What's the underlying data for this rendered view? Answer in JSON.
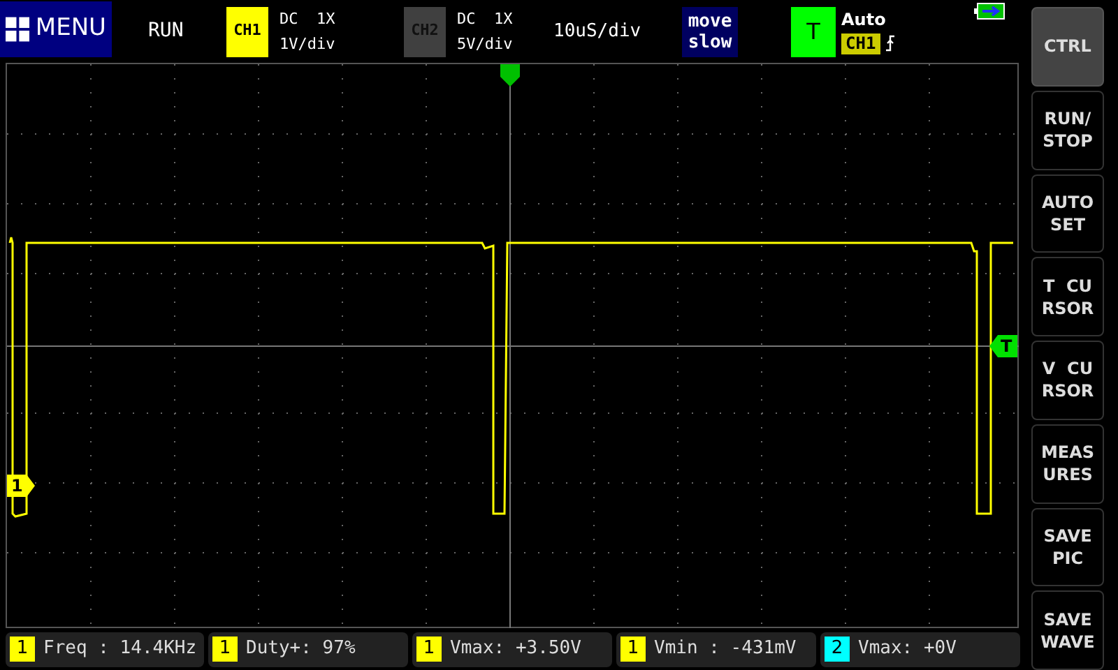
{
  "top_bar": {
    "menu": {
      "label": "MENU"
    },
    "run_state": "RUN",
    "channels": [
      {
        "badge": "CH1",
        "color": "#ffff00",
        "coupling": "DC  1X",
        "scale": "1V/div",
        "enabled": true
      },
      {
        "badge": "CH2",
        "color": "#404040",
        "coupling": "DC  1X",
        "scale": "5V/div",
        "enabled": false
      }
    ],
    "timebase": "10uS/div",
    "move_mode": {
      "lines": [
        "move",
        "slow"
      ]
    },
    "trigger": {
      "badge": "T",
      "mode": "Auto",
      "source": "CH1"
    }
  },
  "side_buttons": [
    {
      "lines": [
        "CTRL"
      ],
      "selected": true
    },
    {
      "lines": [
        "RUN/",
        "STOP"
      ],
      "selected": false
    },
    {
      "lines": [
        "AUTO",
        "SET"
      ],
      "selected": false
    },
    {
      "lines": [
        "T  CU",
        "RSOR"
      ],
      "selected": false
    },
    {
      "lines": [
        "V  CU",
        "RSOR"
      ],
      "selected": false
    },
    {
      "lines": [
        "MEAS",
        "URES"
      ],
      "selected": false
    },
    {
      "lines": [
        "SAVE",
        "PIC"
      ],
      "selected": false
    },
    {
      "lines": [
        "SAVE",
        "WAVE"
      ],
      "selected": false
    }
  ],
  "scope": {
    "channel_marker": "1",
    "trigger_marker": "T"
  },
  "measurements": [
    {
      "channel": "1",
      "color": "#ffff00",
      "reading": "Freq : 14.4KHz"
    },
    {
      "channel": "1",
      "color": "#ffff00",
      "reading": "Duty+: 97%"
    },
    {
      "channel": "1",
      "color": "#ffff00",
      "reading": "Vmax: +3.50V"
    },
    {
      "channel": "1",
      "color": "#ffff00",
      "reading": "Vmin : -431mV"
    },
    {
      "channel": "2",
      "color": "#00ffff",
      "reading": "Vmax: +0V"
    }
  ]
}
